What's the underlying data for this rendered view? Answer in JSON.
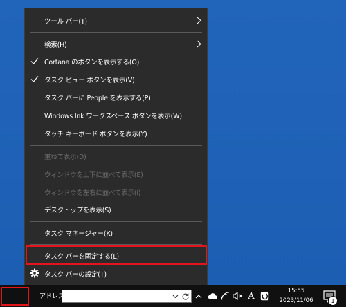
{
  "context_menu": {
    "items": [
      {
        "label": "ツール バー(T)",
        "enabled": true,
        "submenu": true
      },
      {
        "label": "検索(H)",
        "enabled": true,
        "submenu": true
      },
      {
        "label": "Cortana のボタンを表示する(O)",
        "enabled": true,
        "checked": true
      },
      {
        "label": "タスク ビュー ボタンを表示(V)",
        "enabled": true,
        "checked": true
      },
      {
        "label": "タスク バーに People を表示する(P)",
        "enabled": true
      },
      {
        "label": "Windows Ink ワークスペース ボタンを表示(W)",
        "enabled": true
      },
      {
        "label": "タッチ キーボード ボタンを表示(Y)",
        "enabled": true
      },
      {
        "label": "重ねて表示(D)",
        "enabled": false
      },
      {
        "label": "ウィンドウを上下に並べて表示(E)",
        "enabled": false
      },
      {
        "label": "ウィンドウを左右に並べて表示(I)",
        "enabled": false
      },
      {
        "label": "デスクトップを表示(S)",
        "enabled": true
      },
      {
        "label": "タスク マネージャー(K)",
        "enabled": true
      },
      {
        "label": "タスク バーを固定する(L)",
        "enabled": true,
        "highlighted": true
      },
      {
        "label": "タスク バーの設定(T)",
        "enabled": true,
        "icon": "gear-icon"
      }
    ]
  },
  "taskbar": {
    "address_label": "アドレス",
    "address_value": "",
    "clock_time": "15:55",
    "clock_date": "2023/11/06",
    "ime_mode": "A",
    "notification_count": "1",
    "highlight_color": "#e3141b"
  }
}
